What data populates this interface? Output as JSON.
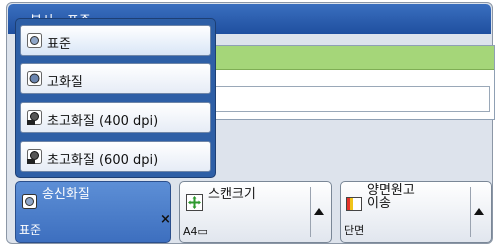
{
  "window": {
    "title": "복사 - 표준"
  },
  "dropdown": {
    "options": [
      {
        "label": "표준",
        "icon": "image-quality-standard-icon",
        "selected": true
      },
      {
        "label": "고화질",
        "icon": "image-quality-high-icon"
      },
      {
        "label": "초고화질 (400 dpi)",
        "icon": "image-quality-400dpi-icon"
      },
      {
        "label": "초고화질 (600 dpi)",
        "icon": "image-quality-600dpi-icon"
      }
    ]
  },
  "buttons": {
    "quality": {
      "label": "송신화질",
      "value": "표준",
      "close_label": "×"
    },
    "scan_size": {
      "label": "스캔크기",
      "value": "A4▭"
    },
    "duplex": {
      "label_line1": "양면원고",
      "label_line2": "이송",
      "value": "단면"
    }
  },
  "colors": {
    "accent": "#3d6fbf",
    "highlight": "#a5d679"
  }
}
